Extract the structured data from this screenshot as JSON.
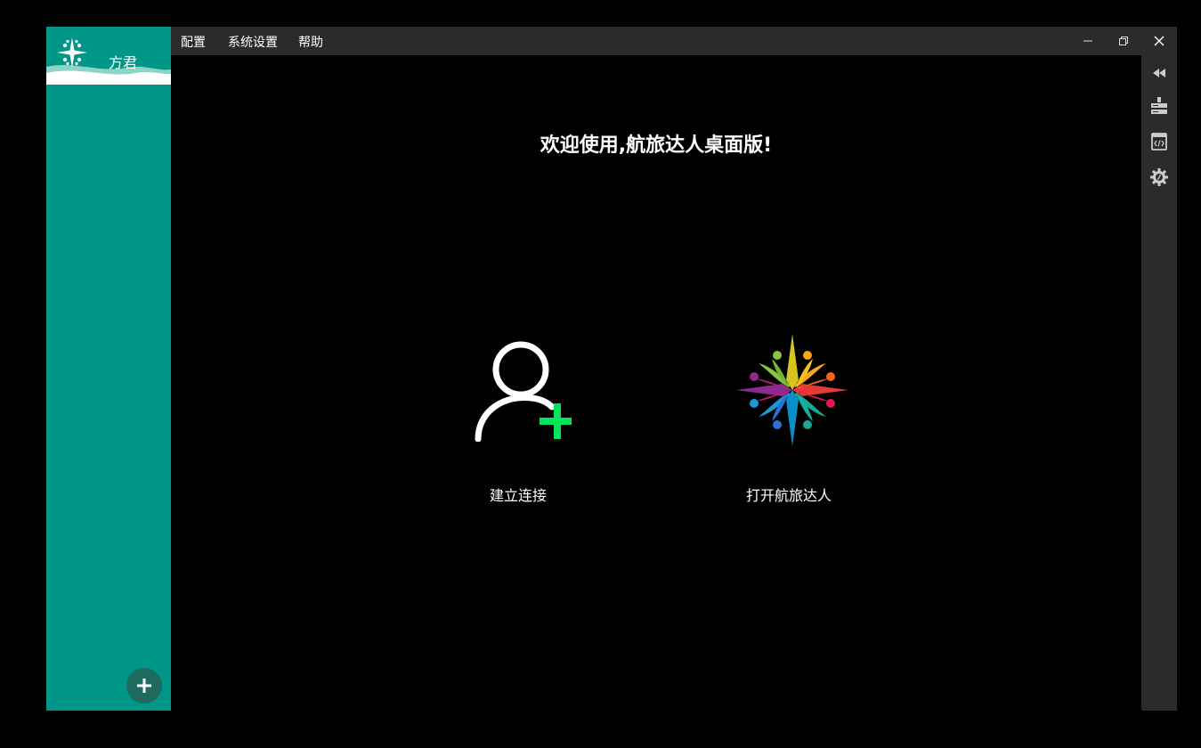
{
  "sidebar": {
    "username": "方君",
    "add_icon": "plus-icon"
  },
  "menubar": {
    "items": [
      "配置",
      "系统设置",
      "帮助"
    ]
  },
  "window_controls": [
    "minimize-icon",
    "restore-icon",
    "close-icon"
  ],
  "rightbar": {
    "icons": [
      "rewind-icon",
      "server-icon",
      "code-icon",
      "gear-icon"
    ]
  },
  "main": {
    "welcome": "欢迎使用,航旅达人桌面版!",
    "actions": [
      {
        "label": "建立连接",
        "icon": "add-user-icon"
      },
      {
        "label": "打开航旅达人",
        "icon": "compass-logo-icon"
      }
    ]
  },
  "colors": {
    "sidebar": "#009688",
    "accent_plus": "#00e65c",
    "bar": "#2b2b2b"
  }
}
